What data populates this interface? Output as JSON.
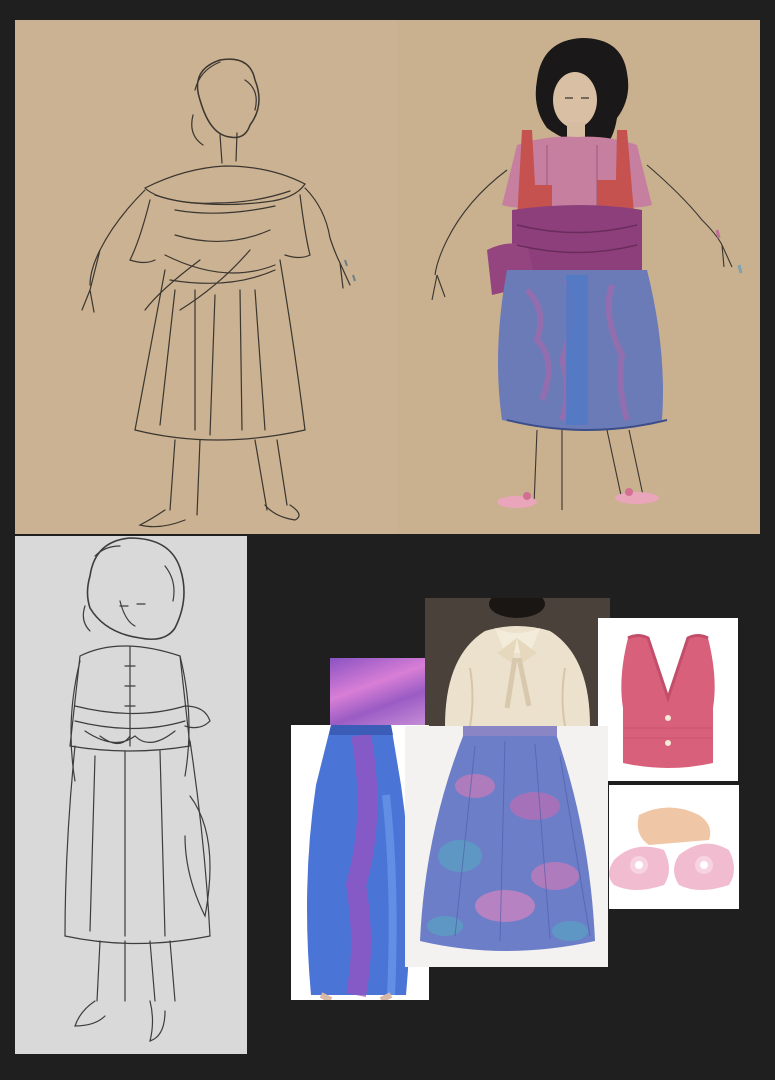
{
  "board": {
    "background": "#1f1f1f",
    "panels": [
      {
        "id": "sketch-pencil-offshoulder",
        "kind": "pencil sketch",
        "paper": "#cbb292"
      },
      {
        "id": "sketch-colored",
        "kind": "colored rendering",
        "paper": "#c9b08f"
      },
      {
        "id": "sketch-pencil-blouse",
        "kind": "pencil sketch",
        "paper": "#d9d9d9"
      }
    ],
    "swatches": [
      {
        "id": "iridescent-fabric",
        "colors": [
          "#c06fc8",
          "#7d4ab8"
        ]
      },
      {
        "id": "satin-bow-blouse",
        "colors": [
          "#efe4cf",
          "#d8c9ae"
        ]
      },
      {
        "id": "pink-knit-vest",
        "colors": [
          "#d9607a",
          "#c94d6c"
        ]
      },
      {
        "id": "iridescent-skirt",
        "colors": [
          "#4a74d6",
          "#8a4bb8"
        ]
      },
      {
        "id": "floral-chiffon-skirt",
        "colors": [
          "#6c7ec8",
          "#c57ab8",
          "#5aa0c2"
        ]
      },
      {
        "id": "pink-bow-flats",
        "colors": [
          "#f2bcd0",
          "#ffffff"
        ]
      }
    ]
  }
}
